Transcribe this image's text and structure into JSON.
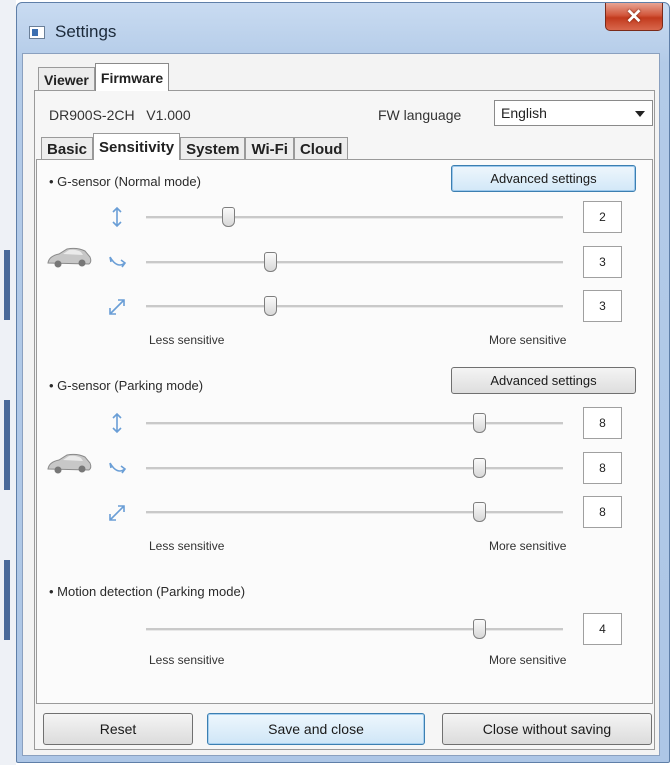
{
  "window": {
    "title": "Settings",
    "close_symbol": "✕"
  },
  "top_tabs": [
    {
      "label": "Viewer",
      "active": false
    },
    {
      "label": "Firmware",
      "active": true
    }
  ],
  "firmware": {
    "model_version": "DR900S-2CH   V1.000",
    "fw_language_label": "FW language",
    "fw_language_value": "English"
  },
  "inner_tabs": [
    {
      "label": "Basic",
      "active": false
    },
    {
      "label": "Sensitivity",
      "active": true
    },
    {
      "label": "System",
      "active": false
    },
    {
      "label": "Wi-Fi",
      "active": false
    },
    {
      "label": "Cloud",
      "active": false
    }
  ],
  "normal_mode": {
    "title": "• G-sensor (Normal mode)",
    "advanced_label": "Advanced settings",
    "sliders": [
      {
        "axis": "vertical-axis-icon",
        "value": "2",
        "level": 0.2
      },
      {
        "axis": "lateral-axis-icon",
        "value": "3",
        "level": 0.3
      },
      {
        "axis": "diagonal-axis-icon",
        "value": "3",
        "level": 0.3
      }
    ],
    "less_label": "Less sensitive",
    "more_label": "More sensitive"
  },
  "parking_mode": {
    "title": "• G-sensor (Parking mode)",
    "advanced_label": "Advanced settings",
    "sliders": [
      {
        "axis": "vertical-axis-icon",
        "value": "8",
        "level": 0.8
      },
      {
        "axis": "lateral-axis-icon",
        "value": "8",
        "level": 0.8
      },
      {
        "axis": "diagonal-axis-icon",
        "value": "8",
        "level": 0.8
      }
    ],
    "less_label": "Less sensitive",
    "more_label": "More sensitive"
  },
  "motion_detection": {
    "title": "• Motion detection (Parking mode)",
    "slider": {
      "value": "4",
      "level": 0.8
    },
    "less_label": "Less sensitive",
    "more_label": "More sensitive"
  },
  "buttons": {
    "reset": "Reset",
    "save_close": "Save and close",
    "close_no_save": "Close without saving"
  },
  "colors": {
    "accent": "#3c7fb1",
    "close_red": "#c23a1d",
    "icon_blue": "#6a9ed6"
  }
}
